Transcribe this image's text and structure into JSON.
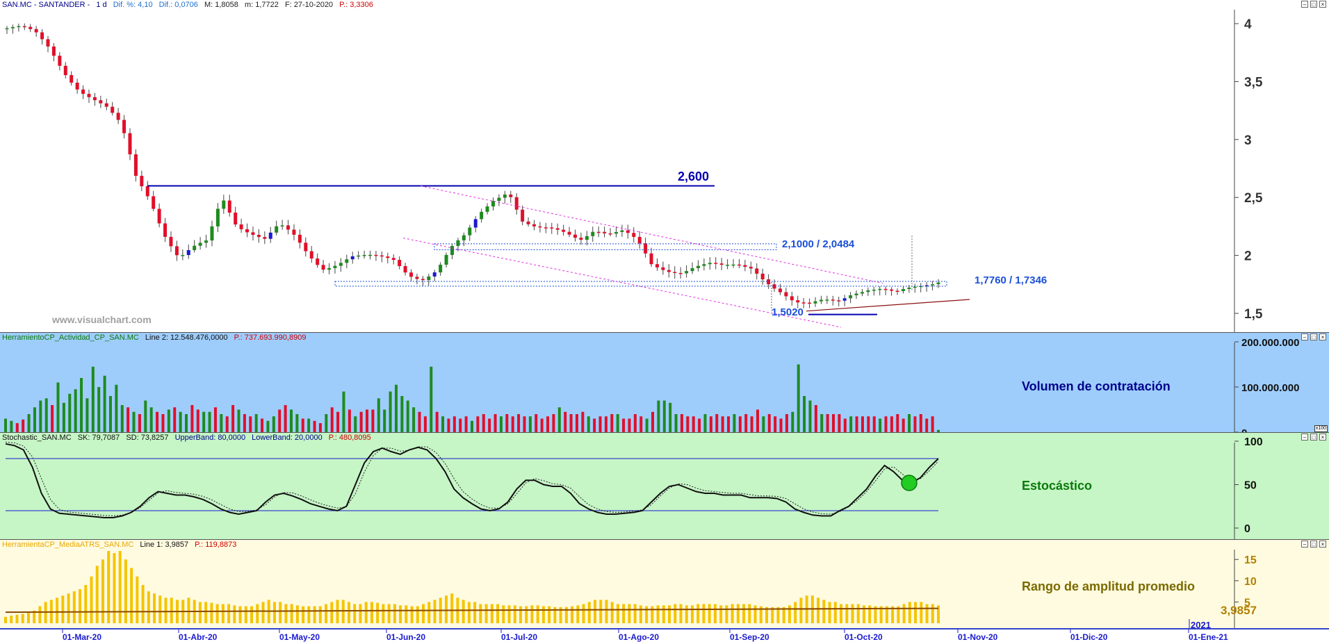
{
  "colors": {
    "up": "#1f8a1f",
    "down": "#e0102a",
    "blue_candle": "#1a1ad0",
    "vol_bg": "#9ecdfc",
    "stoch_bg": "#c6f5c6",
    "atr_bg": "#fffbe0",
    "atr_bar": "#f5c400",
    "level": "#0000b0",
    "channel": "#e030e0"
  },
  "price_header": {
    "symbol": "SAN.MC - SANTANDER -",
    "period": "1 d",
    "dif_pct": "Dif. %: 4,10",
    "dif": "Dif.: 0,0706",
    "max": "M: 1,8058",
    "min": "m: 1,7722",
    "date": "F: 27-10-2020",
    "p": "P.: 3,3306"
  },
  "volume_header": {
    "name": "HerramientoCP_Actividad_CP_SAN.MC",
    "line2": "Line 2: 12.548.476,0000",
    "p": "P.: 737.693.990,8909"
  },
  "stoch_header": {
    "name": "Stochastic_SAN.MC",
    "sk": "SK: 79,7087",
    "sd": "SD: 73,8257",
    "upper": "UpperBand: 80,0000",
    "lower": "LowerBand: 20,0000",
    "p": "P.: 480,8095"
  },
  "atr_header": {
    "name": "HerramientaCP_MediaATRS_SAN.MC",
    "line1": "Line 1: 3,9857",
    "p": "P.: 119,8873"
  },
  "watermark": "www.visualchart.com",
  "annotations": {
    "resistance": "2,600",
    "zone1": "2,1000 / 2,0484",
    "zone2": "1,7760 / 1,7346",
    "low": "1,5020"
  },
  "panel_titles": {
    "volume": "Volumen de contratación",
    "stoch": "Estocástico",
    "atr": "Rango de amplitud promedio"
  },
  "atr_last_value": "3,9857",
  "axis_badge": "x100",
  "year_label": "2021",
  "chart_data": [
    {
      "type": "candlestick",
      "title": "SAN.MC - SANTANDER",
      "x_ticks": [
        "01-Mar-20",
        "01-Abr-20",
        "01-May-20",
        "01-Jun-20",
        "01-Jul-20",
        "01-Ago-20",
        "01-Sep-20",
        "01-Oct-20",
        "01-Nov-20",
        "01-Dic-20",
        "01-Ene-21"
      ],
      "y_ticks": [
        "4",
        "3,5",
        "3",
        "2,5",
        "2",
        "1,5"
      ],
      "ylim": [
        1.35,
        4.1
      ],
      "close_path": [
        3.96,
        3.95,
        3.9,
        3.78,
        3.6,
        3.45,
        3.35,
        3.25,
        3.1,
        2.68,
        2.5,
        2.2,
        1.98,
        2.05,
        2.1,
        2.5,
        2.28,
        2.22,
        2.15,
        2.25,
        2.15,
        2.0,
        1.9,
        1.95,
        2.0,
        1.98,
        1.96,
        1.95,
        1.85,
        1.82,
        1.88,
        2.05,
        2.15,
        2.35,
        2.5,
        2.58,
        2.3,
        2.22,
        2.2,
        2.18,
        2.15,
        2.25,
        2.2,
        2.2,
        2.1,
        1.9,
        1.88,
        1.88,
        1.92,
        1.92,
        1.88,
        1.9,
        1.9,
        1.8,
        1.7,
        1.58,
        1.55,
        1.6,
        1.62,
        1.7,
        1.72,
        1.7,
        1.65,
        1.7,
        1.75,
        1.8
      ],
      "levels": [
        2.6,
        2.1,
        2.0484,
        1.776,
        1.7346,
        1.502
      ]
    },
    {
      "type": "bar",
      "title": "Volumen de contratación",
      "y_ticks": [
        "200.000.000",
        "100.000.000",
        "0"
      ],
      "ylim": [
        0,
        210000000
      ],
      "values_millions": [
        30,
        25,
        20,
        28,
        40,
        55,
        70,
        75,
        60,
        110,
        65,
        85,
        95,
        120,
        75,
        145,
        100,
        125,
        80,
        105,
        60,
        55,
        45,
        40,
        70,
        55,
        45,
        40,
        50,
        55,
        45,
        40,
        60,
        50,
        45,
        45,
        55,
        40,
        35,
        60,
        50,
        40,
        35,
        40,
        30,
        25,
        35,
        50,
        60,
        50,
        40,
        30,
        30,
        25,
        20,
        40,
        55,
        45,
        90,
        50,
        35,
        45,
        50,
        50,
        75,
        50,
        90,
        105,
        80,
        70,
        55,
        45,
        35,
        145,
        45,
        35,
        30,
        35,
        30,
        35,
        25,
        35,
        40,
        30,
        40,
        35,
        40,
        35,
        40,
        35,
        35,
        40,
        30,
        35,
        40,
        55,
        45,
        40,
        40,
        45,
        35,
        30,
        35,
        35,
        40,
        40,
        30,
        30,
        40,
        35,
        30,
        45,
        70,
        70,
        65,
        40,
        40,
        35,
        35,
        30,
        40,
        35,
        40,
        35,
        35,
        40,
        35,
        40,
        35,
        50,
        35,
        40,
        35,
        30,
        40,
        45,
        150,
        80,
        70,
        60,
        40,
        40,
        40,
        40,
        30,
        35,
        35,
        35,
        35,
        35,
        30,
        35,
        35,
        40,
        30,
        40,
        35,
        40,
        30,
        35,
        5
      ]
    },
    {
      "type": "line",
      "title": "Estocástico",
      "y_ticks": [
        "100",
        "50",
        "0"
      ],
      "ylim": [
        0,
        100
      ],
      "bands": [
        80,
        20
      ],
      "sk": [
        97,
        95,
        90,
        70,
        40,
        22,
        17,
        16,
        15,
        14,
        13,
        12,
        12,
        14,
        18,
        25,
        35,
        42,
        40,
        38,
        38,
        36,
        33,
        28,
        22,
        18,
        16,
        18,
        20,
        30,
        38,
        40,
        37,
        33,
        28,
        25,
        22,
        20,
        25,
        50,
        75,
        88,
        92,
        88,
        85,
        90,
        93,
        90,
        80,
        65,
        45,
        35,
        28,
        22,
        20,
        22,
        30,
        45,
        55,
        55,
        50,
        48,
        48,
        40,
        28,
        22,
        18,
        16,
        16,
        17,
        18,
        20,
        30,
        40,
        48,
        50,
        46,
        42,
        40,
        40,
        38,
        38,
        38,
        35,
        35,
        35,
        34,
        30,
        22,
        18,
        15,
        14,
        14,
        20,
        25,
        35,
        45,
        60,
        72,
        65,
        55,
        52,
        58,
        70,
        80
      ],
      "sk_last": 79.7087,
      "sd_last": 73.8257
    },
    {
      "type": "bar",
      "title": "Rango de amplitud promedio",
      "y_ticks": [
        "15",
        "10",
        "5"
      ],
      "ylim": [
        0,
        17
      ],
      "line_value": 3.9857,
      "values": [
        1.5,
        1.8,
        2,
        2.2,
        2.5,
        3,
        4,
        5,
        5.5,
        6,
        6.5,
        7,
        7.5,
        8,
        9,
        11,
        13.5,
        15,
        17,
        16.5,
        17,
        15,
        13,
        11,
        9,
        7.5,
        7,
        6.5,
        6,
        6,
        5.5,
        5.5,
        6,
        5.5,
        5,
        5,
        4.8,
        4.5,
        4.5,
        4.5,
        4.2,
        4,
        4,
        4,
        4.5,
        5,
        5.5,
        5,
        5,
        4.5,
        4.5,
        4.2,
        4,
        4,
        4,
        4,
        4.5,
        5,
        5.5,
        5.5,
        5,
        4.5,
        4.5,
        5,
        5,
        4.8,
        4.5,
        4.5,
        4.5,
        4.2,
        4.2,
        4,
        4,
        4.5,
        5,
        5.5,
        6,
        6.5,
        7,
        6,
        5.5,
        5,
        5,
        4.5,
        4.5,
        4.5,
        4.5,
        4.2,
        4.2,
        4.2,
        4,
        4,
        4.2,
        4.2,
        4,
        4,
        3.8,
        3.8,
        3.8,
        4,
        4.2,
        4.5,
        5,
        5.5,
        5.5,
        5.5,
        5,
        4.5,
        4.5,
        4.5,
        4.5,
        4.2,
        4,
        4,
        4.2,
        4.2,
        4.2,
        4.5,
        4.5,
        4.2,
        4.2,
        4.5,
        4.5,
        4.5,
        4.5,
        4.2,
        4.2,
        4.5,
        4.5,
        4.5,
        4.5,
        4.2,
        4,
        3.8,
        3.8,
        3.8,
        3.8,
        4.2,
        5,
        6,
        6.5,
        6.5,
        6,
        5.5,
        5,
        5,
        4.5,
        4.5,
        4.5,
        4.5,
        4.2,
        4.2,
        4,
        4,
        4,
        4,
        4,
        4.5,
        5,
        5,
        5,
        4.5,
        4.5,
        4.2
      ]
    }
  ]
}
